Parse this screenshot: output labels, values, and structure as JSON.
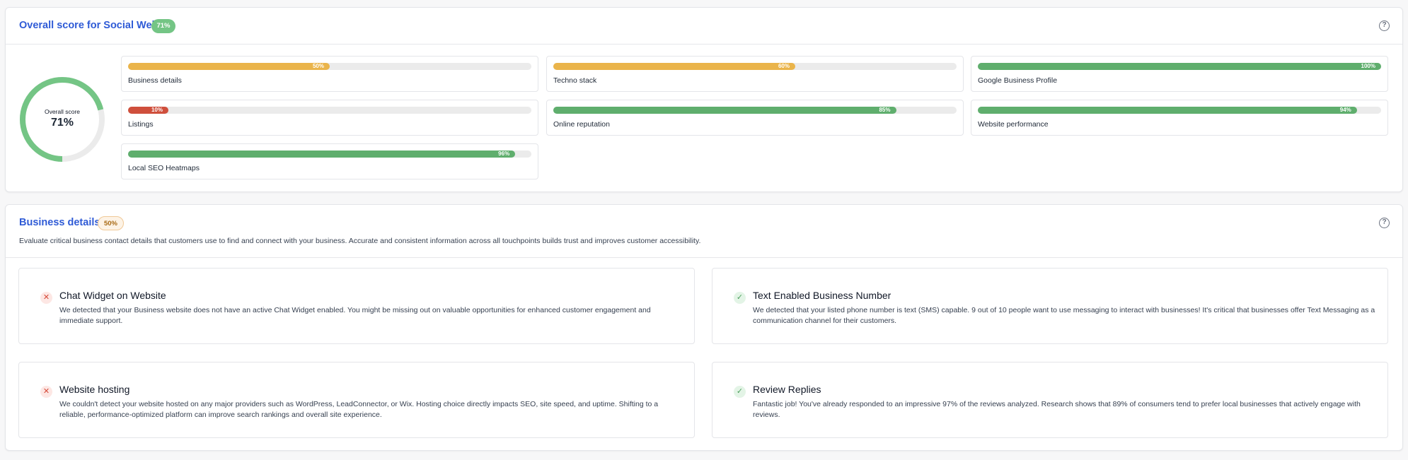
{
  "overall": {
    "title": "Overall score for Social Web",
    "badge": "71%",
    "help_icon": "question-circle-icon",
    "donut": {
      "label": "Overall score",
      "value_text": "71%",
      "value": 71,
      "color": "#74c585",
      "track_color": "#ebebeb"
    },
    "metrics": [
      {
        "label": "Business details",
        "percent_text": "50%",
        "value": 50,
        "color": "#eab44a"
      },
      {
        "label": "Techno stack",
        "percent_text": "60%",
        "value": 60,
        "color": "#eab44a"
      },
      {
        "label": "Google Business Profile",
        "percent_text": "100%",
        "value": 100,
        "color": "#5fae6d"
      },
      {
        "label": "Listings",
        "percent_text": "10%",
        "value": 10,
        "color": "#cf4f3c"
      },
      {
        "label": "Online reputation",
        "percent_text": "85%",
        "value": 85,
        "color": "#5fae6d"
      },
      {
        "label": "Website performance",
        "percent_text": "94%",
        "value": 94,
        "color": "#5fae6d"
      },
      {
        "label": "Local SEO Heatmaps",
        "percent_text": "96%",
        "value": 96,
        "color": "#5fae6d"
      }
    ]
  },
  "details": {
    "title": "Business details",
    "badge": "50%",
    "help_icon": "question-circle-icon",
    "description": "Evaluate critical business contact details that customers use to find and connect with your business. Accurate and consistent information across all touchpoints builds trust and improves customer accessibility.",
    "items": [
      {
        "status": "fail",
        "icon": "x-icon",
        "title": "Chat Widget on Website",
        "body": "We detected that your Business website does not have an active Chat Widget enabled. You might be missing out on valuable opportunities for enhanced customer engagement and immediate support."
      },
      {
        "status": "pass",
        "icon": "check-icon",
        "title": "Text Enabled Business Number",
        "body": "We detected that your listed phone number is text (SMS) capable. 9 out of 10 people want to use messaging to interact with businesses! It's critical that businesses offer Text Messaging as a communication channel for their customers."
      },
      {
        "status": "fail",
        "icon": "x-icon",
        "title": "Website hosting",
        "body": "We couldn't detect your website hosted on any major providers such as WordPress, LeadConnector, or Wix. Hosting choice directly impacts SEO, site speed, and uptime. Shifting to a reliable, performance-optimized platform can improve search rankings and overall site experience."
      },
      {
        "status": "pass",
        "icon": "check-icon",
        "title": "Review Replies",
        "body": "Fantastic job! You've already responded to an impressive 97% of the reviews analyzed. Research shows that 89% of consumers tend to prefer local businesses that actively engage with reviews."
      }
    ]
  }
}
